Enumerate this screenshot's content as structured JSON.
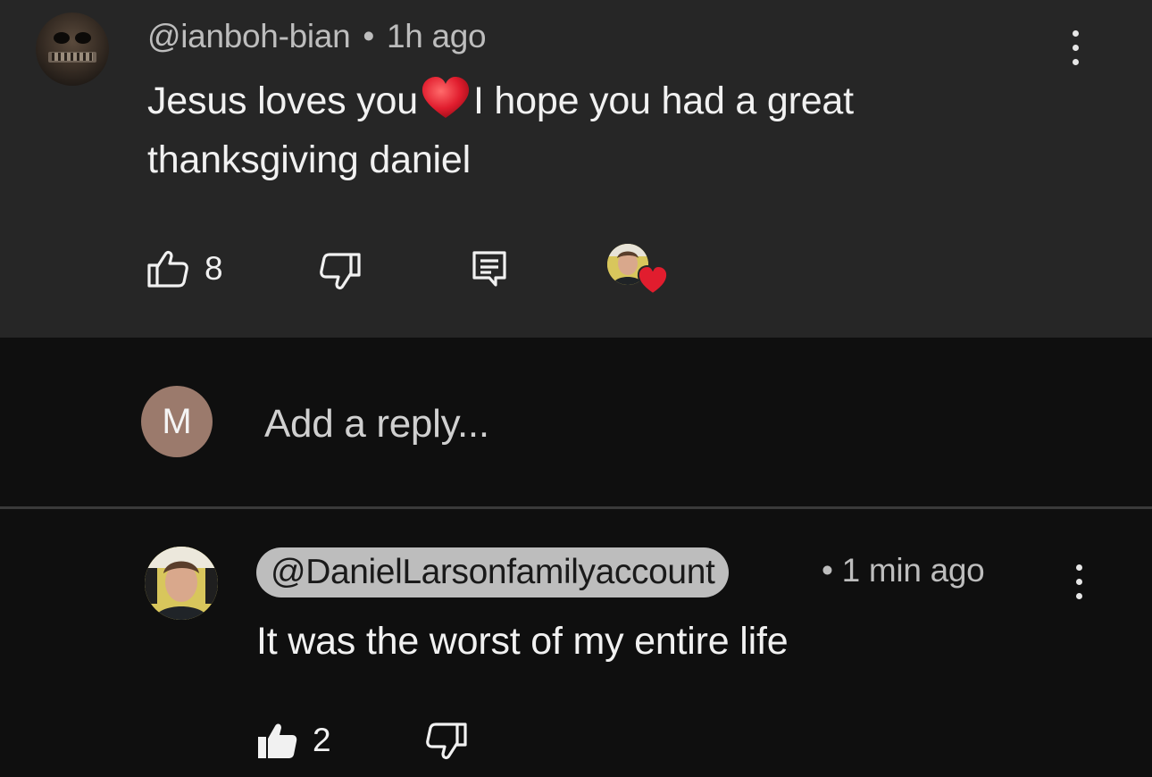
{
  "comment": {
    "author": "@ianboh-bian",
    "separator": "•",
    "time": "1h ago",
    "text_before_heart": "Jesus loves you",
    "text_after_heart": "I hope you had a great",
    "text_line2": "thanksgiving daniel",
    "like_count": "8",
    "heart_color": "#e11d2e"
  },
  "reply_input": {
    "avatar_letter": "M",
    "placeholder": "Add a reply...",
    "avatar_color": "#9b7a6c"
  },
  "reply": {
    "author": "@DanielLarsonfamilyaccount",
    "separator": "•",
    "time": "1 min ago",
    "text": "It was the worst of my entire life",
    "like_count": "2"
  },
  "icons": {
    "like": "thumbs-up-icon",
    "dislike": "thumbs-down-icon",
    "reply": "reply-comment-icon",
    "more": "more-vertical-icon",
    "creator_heart": "creator-heart-icon"
  }
}
